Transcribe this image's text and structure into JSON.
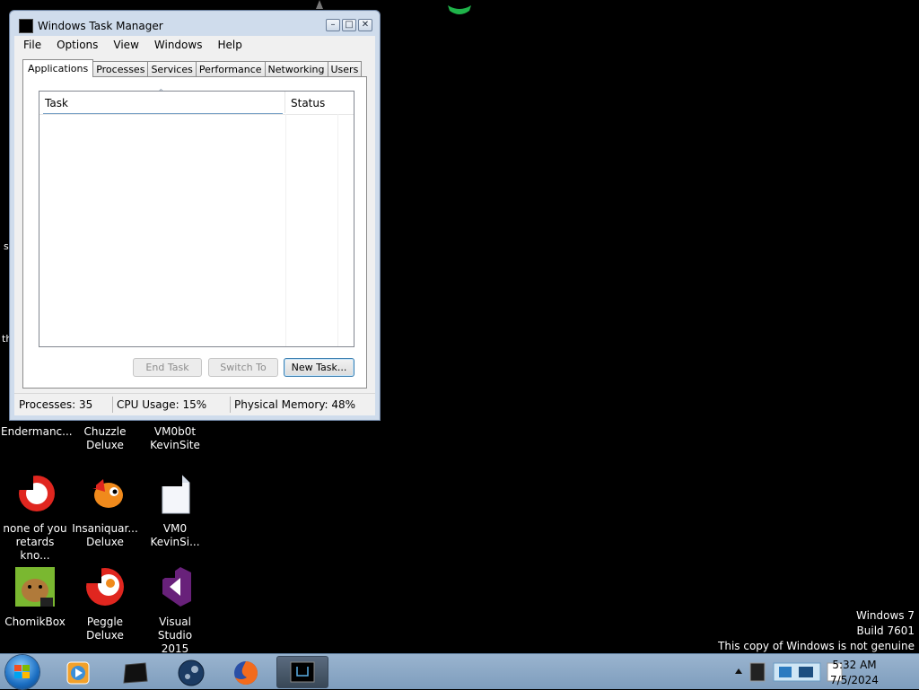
{
  "window": {
    "title": "Windows Task Manager",
    "controls": [
      "minimize",
      "maximize",
      "close"
    ]
  },
  "menu": [
    "File",
    "Options",
    "View",
    "Windows",
    "Help"
  ],
  "tabs": [
    {
      "label": "Applications",
      "active": true
    },
    {
      "label": "Processes",
      "active": false
    },
    {
      "label": "Services",
      "active": false
    },
    {
      "label": "Performance",
      "active": false
    },
    {
      "label": "Networking",
      "active": false
    },
    {
      "label": "Users",
      "active": false
    }
  ],
  "list": {
    "columns": {
      "task": "Task",
      "status": "Status"
    },
    "rows": []
  },
  "buttons": {
    "end_task": "End Task",
    "switch_to": "Switch To",
    "new_task": "New Task..."
  },
  "status": {
    "processes": "Processes: 35",
    "cpu": "CPU Usage: 15%",
    "memory": "Physical Memory: 48%"
  },
  "desktop": {
    "edge_chars": [
      "s",
      "th"
    ],
    "icons": [
      {
        "label": "Endermanc...",
        "icon": "app-icon"
      },
      {
        "label": "Chuzzle\nDeluxe",
        "icon": "chuzzle-icon"
      },
      {
        "label": "VM0b0t\nKevinSite",
        "icon": "shortcut-icon"
      },
      {
        "label": "none of you\nretards kno...",
        "icon": "red-circle-icon"
      },
      {
        "label": "Insaniquar...\nDeluxe",
        "icon": "fish-icon"
      },
      {
        "label": "VM0\nKevinSi...",
        "icon": "document-icon"
      },
      {
        "label": "ChomikBox",
        "icon": "hamster-icon"
      },
      {
        "label": "Peggle Deluxe",
        "icon": "peggle-icon"
      },
      {
        "label": "Visual Studio\n2015",
        "icon": "visual-studio-icon"
      }
    ]
  },
  "watermark": {
    "line1": "Windows 7",
    "line2": "Build 7601",
    "line3": "This copy of Windows is not genuine"
  },
  "taskbar": {
    "items": [
      "windows-media-player-icon",
      "terminal-icon",
      "steam-icon",
      "firefox-icon",
      "task-manager-icon"
    ],
    "active_item": "task-manager-icon"
  },
  "clock": {
    "time": "5:32 AM",
    "date": "7/5/2024"
  },
  "colors": {
    "desktop": "#000000",
    "window_frame": "#cfdcec",
    "taskbar": "#8aa7c6",
    "default_button_border": "#3c7fb1"
  }
}
